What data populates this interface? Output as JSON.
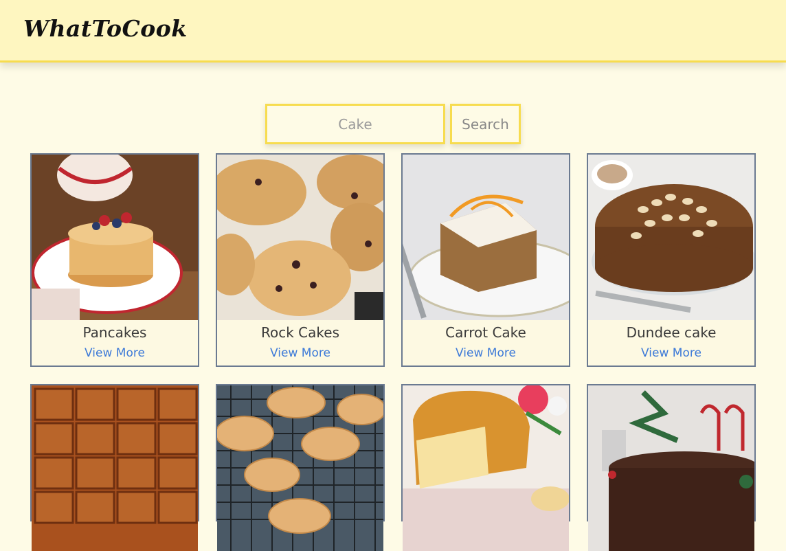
{
  "header": {
    "logo": "WhatToCook"
  },
  "search": {
    "placeholder": "Cake",
    "button_label": "Search"
  },
  "recipes": [
    {
      "title": "Pancakes",
      "link": "View More"
    },
    {
      "title": "Rock Cakes",
      "link": "View More"
    },
    {
      "title": "Carrot Cake",
      "link": "View More"
    },
    {
      "title": "Dundee cake",
      "link": "View More"
    },
    {
      "title": "",
      "link": ""
    },
    {
      "title": "",
      "link": ""
    },
    {
      "title": "",
      "link": ""
    },
    {
      "title": "",
      "link": ""
    }
  ],
  "colors": {
    "header_bg": "#fef6c0",
    "accent_yellow": "#f7dc4f",
    "page_bg": "#fefbe6",
    "card_border": "#6b7a91",
    "link_blue": "#3d7ad8"
  }
}
